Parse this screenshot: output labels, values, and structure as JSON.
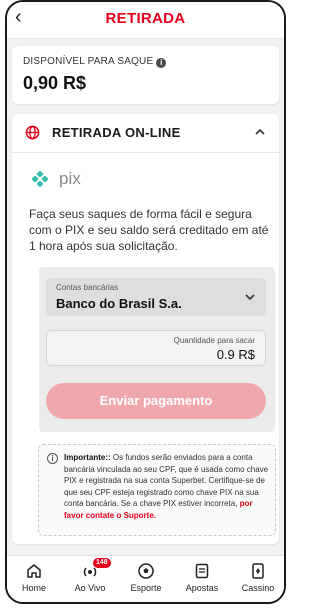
{
  "header": {
    "title": "RETIRADA",
    "back_icon": "chevron-left-icon"
  },
  "balance": {
    "label": "DISPONÍVEL PARA SAQUE",
    "info_icon": "info-icon",
    "value": "0,90 R$"
  },
  "section": {
    "title": "RETIRADA ON-LINE",
    "icon": "globe-icon",
    "expanded": true,
    "pix_logo_text": "pix",
    "description": "Faça seus saques de forma fácil e segura com o PIX e seu saldo será creditado em até 1 hora após sua solicitação."
  },
  "form": {
    "bank_label": "Contas bancárias",
    "bank_value": "Banco do Brasil S.a.",
    "amount_label": "Quantidade para sacar",
    "amount_value": "0.9 R$",
    "submit_label": "Enviar pagamento"
  },
  "notice": {
    "title": "Importante::",
    "body": " Os fundos serão enviados para a conta bancária vinculada ao seu CPF, que é usada como chave PIX e registrada na sua conta Superbet. Certifique-se de que seu CPF esteja registrado como chave PIX na sua conta bancária. Se a chave PIX estiver incorreta,",
    "link": "por favor contate o Suporte."
  },
  "nav": {
    "items": [
      {
        "label": "Home",
        "icon": "home-icon"
      },
      {
        "label": "Ao Vivo",
        "icon": "live-icon",
        "badge": "148"
      },
      {
        "label": "Esporte",
        "icon": "soccer-ball-icon"
      },
      {
        "label": "Apostas",
        "icon": "betslip-icon"
      },
      {
        "label": "Cassino",
        "icon": "casino-icon"
      }
    ]
  },
  "colors": {
    "brand": "#e4001b",
    "button_disabled": "#f1a8ad",
    "pix": "#32bcad"
  }
}
